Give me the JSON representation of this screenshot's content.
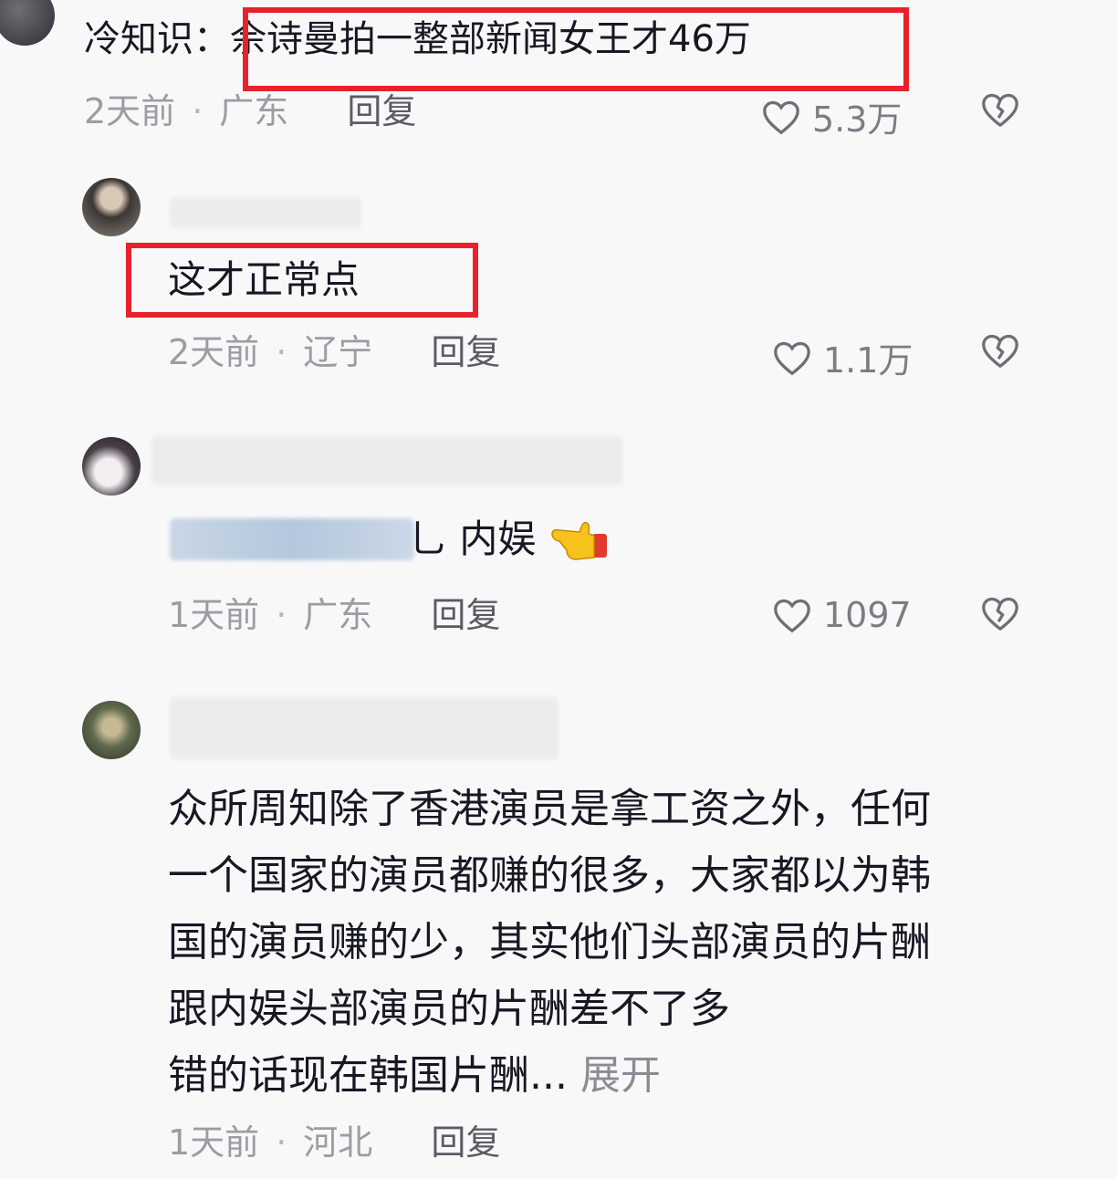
{
  "comments": [
    {
      "prefix": "冷知识：",
      "highlight": "佘诗曼拍一整部新闻女王才46万",
      "time": "2天前",
      "location": "广东",
      "reply_label": "回复",
      "likes": "5.3万"
    },
    {
      "text": "这才正常点",
      "time": "2天前",
      "location": "辽宁",
      "reply_label": "回复",
      "likes": "1.1万"
    },
    {
      "text_tail": "乚 内娱",
      "time": "1天前",
      "location": "广东",
      "reply_label": "回复",
      "likes": "1097"
    },
    {
      "lines": [
        "众所周知除了香港演员是拿工资之外，任何",
        "一个国家的演员都赚的很多，大家都以为韩",
        "国的演员赚的少，其实他们头部演员的片酬",
        "跟内娱头部演员的片酬差不了多",
        "错的话现在韩国片酬..."
      ],
      "expand_label": "展开",
      "time": "1天前",
      "location": "河北",
      "reply_label": "回复"
    }
  ],
  "colors": {
    "highlight_box": "#e8212a",
    "meta_text": "#9c9da3"
  },
  "icons": [
    "heart-outline-icon",
    "broken-heart-icon",
    "pointing-hand-emoji"
  ]
}
